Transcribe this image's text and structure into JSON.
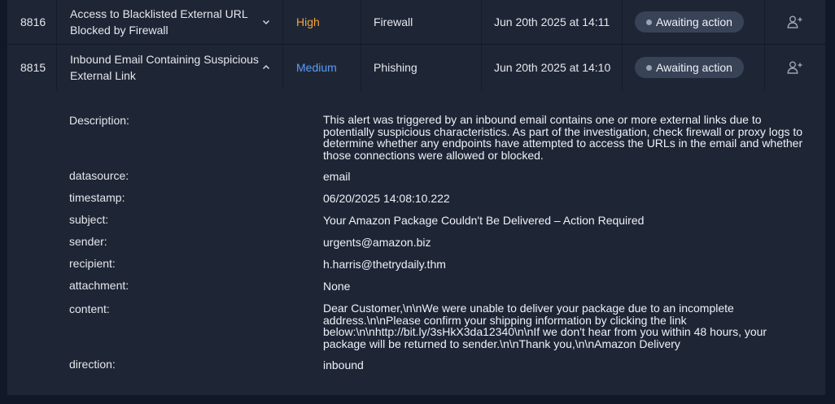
{
  "alerts": [
    {
      "id": "8816",
      "title": "Access to Blacklisted External URL Blocked by Firewall",
      "severity": "High",
      "type": "Firewall",
      "date": "Jun 20th 2025 at 14:11",
      "status": "Awaiting action",
      "expanded": false
    },
    {
      "id": "8815",
      "title": "Inbound Email Containing Suspicious External Link",
      "severity": "Medium",
      "type": "Phishing",
      "date": "Jun 20th 2025 at 14:10",
      "status": "Awaiting action",
      "expanded": true
    }
  ],
  "details": {
    "description_label": "Description:",
    "description": "This alert was triggered by an inbound email contains one or more external links due to potentially suspicious characteristics. As part of the investigation, check firewall or proxy logs to determine whether any endpoints have attempted to access the URLs in the email and whether those connections were allowed or blocked.",
    "datasource_label": "datasource:",
    "datasource": "email",
    "timestamp_label": "timestamp:",
    "timestamp": "06/20/2025 14:08:10.222",
    "subject_label": "subject:",
    "subject": "Your Amazon Package Couldn't Be Delivered – Action Required",
    "sender_label": "sender:",
    "sender": "urgents@amazon.biz",
    "recipient_label": "recipient:",
    "recipient": "h.harris@thetrydaily.thm",
    "attachment_label": "attachment:",
    "attachment": "None",
    "content_label": "content:",
    "content": "Dear Customer,\\n\\nWe were unable to deliver your package due to an incomplete address.\\n\\nPlease confirm your shipping information by clicking the link below:\\n\\nhttp://bit.ly/3sHkX3da12340\\n\\nIf we don't hear from you within 48 hours, your package will be returned to sender.\\n\\nThank you,\\n\\nAmazon Delivery",
    "direction_label": "direction:",
    "direction": "inbound"
  },
  "colors": {
    "background": "#111827",
    "panel": "#1e2636",
    "severity_high": "#f5a33b",
    "severity_medium": "#5b9cf6",
    "badge": "#394357"
  },
  "icons": {
    "expand": "chevron-down-icon",
    "collapse": "chevron-up-icon",
    "assign": "user-plus-icon"
  }
}
